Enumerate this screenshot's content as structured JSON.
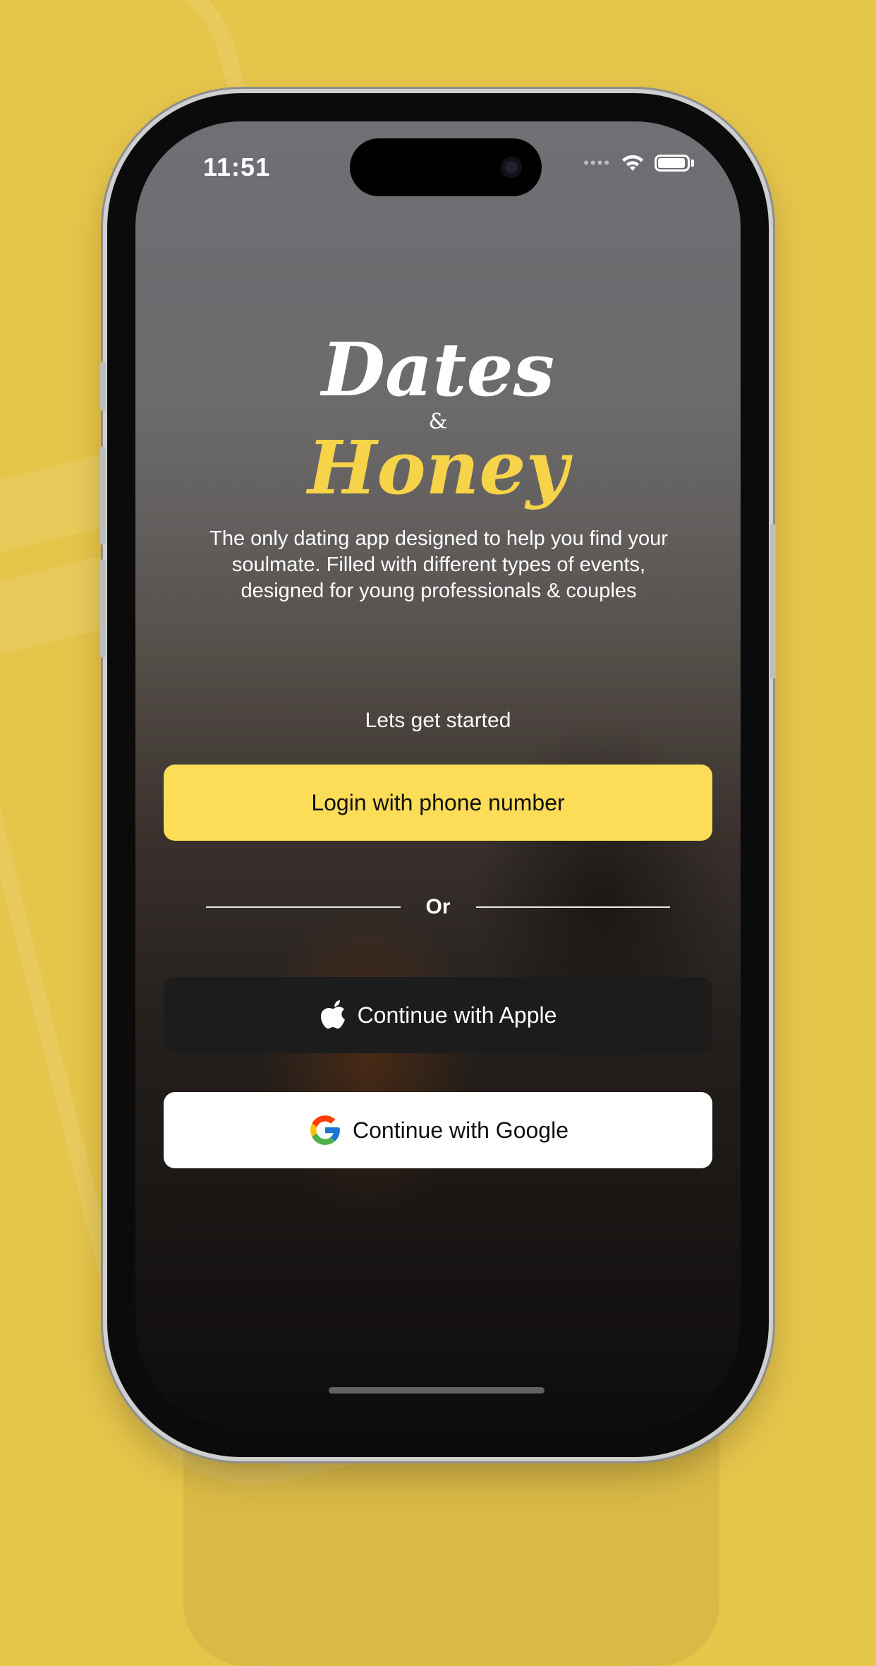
{
  "status_bar": {
    "time": "11:51"
  },
  "logo": {
    "line1": "Dates",
    "ampersand": "&",
    "line2": "Honey"
  },
  "tagline": "The only dating app designed to help you find your soulmate. Filled with different types of events, designed for young professionals & couples",
  "start_label": "Lets get started",
  "buttons": {
    "phone_login": "Login with phone number",
    "apple": "Continue with Apple",
    "google": "Continue with Google"
  },
  "divider": {
    "label": "Or"
  },
  "colors": {
    "background": "#e6c54b",
    "accent": "#fddc58",
    "honey_text": "#f6d349",
    "apple_button": "#1c1c1c"
  },
  "icons": {
    "apple": "apple-logo-icon",
    "google": "google-logo-icon",
    "wifi": "wifi-icon",
    "battery": "battery-icon"
  }
}
